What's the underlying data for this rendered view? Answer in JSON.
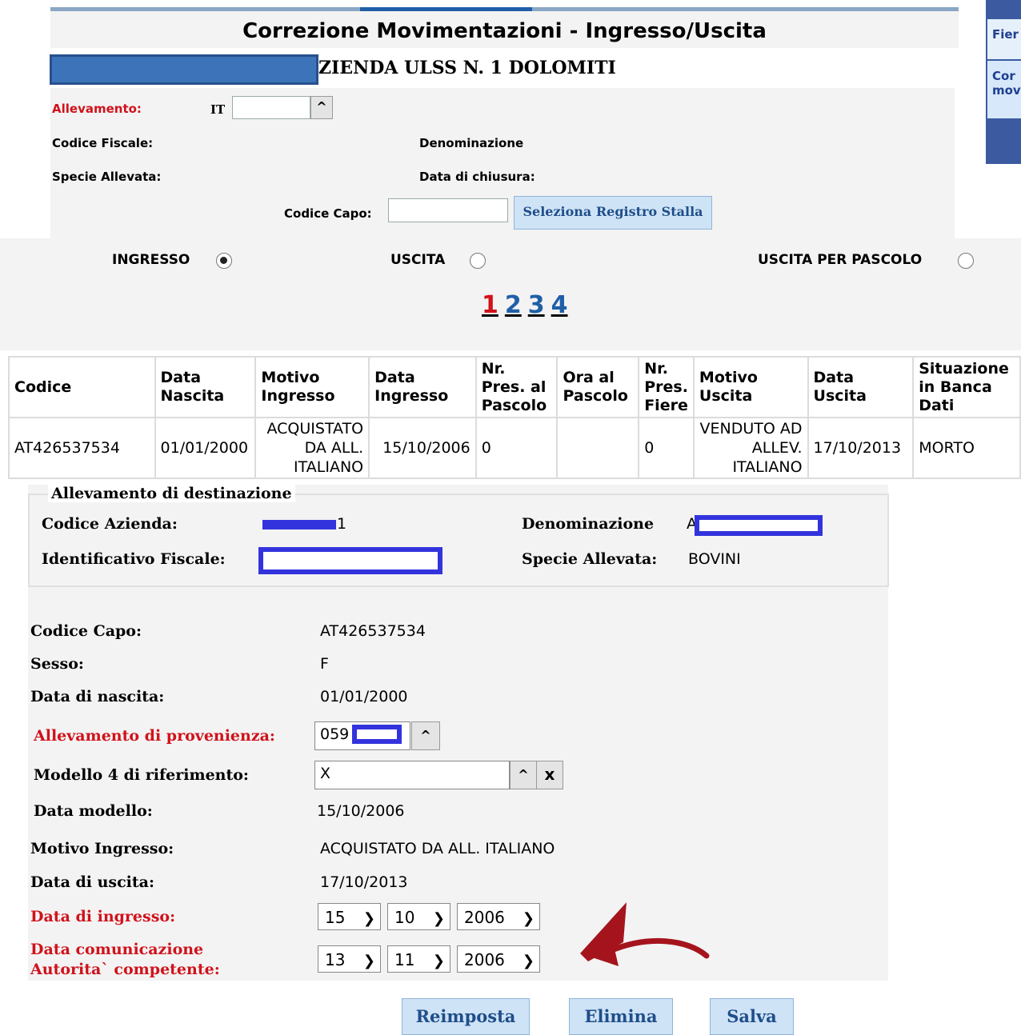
{
  "header": {
    "title": "Correzione Movimentazioni - Ingresso/Uscita",
    "azienda": "ZIENDA ULSS N. 1 DOLOMITI"
  },
  "right_panel": {
    "item1": "Fier",
    "item2_line1": "Cor",
    "item2_line2": "mov"
  },
  "form": {
    "allevamento_label": "Allevamento:",
    "allevamento_prefix": "IT",
    "allevamento_value": "",
    "codice_fiscale_label": "Codice Fiscale:",
    "denominazione_label": "Denominazione",
    "specie_label": "Specie Allevata:",
    "data_chiusura_label": "Data di chiusura:",
    "codice_capo_label": "Codice Capo:",
    "codice_capo_value": "",
    "seleziona_button": "Seleziona Registro Stalla",
    "arrow_glyph": "^"
  },
  "radios": {
    "ingresso": "INGRESSO",
    "uscita": "USCITA",
    "uscita_pascolo": "USCITA PER PASCOLO",
    "selected": "ingresso"
  },
  "pagination": {
    "pages": [
      "1",
      "2",
      "3",
      "4"
    ],
    "current": "1"
  },
  "table": {
    "headers": [
      "Codice",
      "Data Nascita",
      "Motivo Ingresso",
      "Data Ingresso",
      "Nr. Pres. al Pascolo",
      "Ora al Pascolo",
      "Nr. Pres. Fiere",
      "Motivo Uscita",
      "Data Uscita",
      "Situazione in Banca Dati"
    ],
    "row": {
      "codice": "AT426537534",
      "data_nascita": "01/01/2000",
      "motivo_ingresso": "ACQUISTATO DA ALL. ITALIANO",
      "data_ingresso": "15/10/2006",
      "nr_pres_pascolo": "0",
      "ora_pascolo": "",
      "nr_pres_fiere": "0",
      "motivo_uscita": "VENDUTO AD ALLEV. ITALIANO",
      "data_uscita": "17/10/2013",
      "situazione": "MORTO"
    }
  },
  "destinazione": {
    "legend": "Allevamento di destinazione",
    "codice_azienda_label": "Codice Azienda:",
    "codice_azienda_suffix": "1",
    "denominazione_label": "Denominazione",
    "denominazione_prefix": "A",
    "id_fiscale_label": "Identificativo Fiscale:",
    "specie_label": "Specie Allevata:",
    "specie_value": "BOVINI"
  },
  "details": {
    "codice_capo_label": "Codice Capo:",
    "codice_capo_value": "AT426537534",
    "sesso_label": "Sesso:",
    "sesso_value": "F",
    "data_nascita_label": "Data di nascita:",
    "data_nascita_value": "01/01/2000",
    "provenienza_label": "Allevamento di provenienza:",
    "provenienza_value": "059",
    "modello4_label": "Modello 4 di riferimento:",
    "modello4_value": "X",
    "data_modello_label": "Data modello:",
    "data_modello_value": "15/10/2006",
    "motivo_ingresso_label": "Motivo Ingresso:",
    "motivo_ingresso_value": "ACQUISTATO DA ALL. ITALIANO",
    "data_uscita_label": "Data di uscita:",
    "data_uscita_value": "17/10/2013",
    "data_ingresso_label": "Data di ingresso:",
    "data_ingresso": {
      "day": "15",
      "month": "10",
      "year": "2006"
    },
    "data_comunicazione_label_line1": "Data comunicazione",
    "data_comunicazione_label_line2": "Autorita` competente:",
    "data_comunicazione": {
      "day": "13",
      "month": "11",
      "year": "2006"
    },
    "clear_glyph": "x"
  },
  "buttons": {
    "reimposta": "Reimposta",
    "elimina": "Elimina",
    "salva": "Salva"
  },
  "colors": {
    "required_label": "#d0121b",
    "button_bg": "#cfe3f6",
    "arrow_annotation": "#a5141d"
  }
}
